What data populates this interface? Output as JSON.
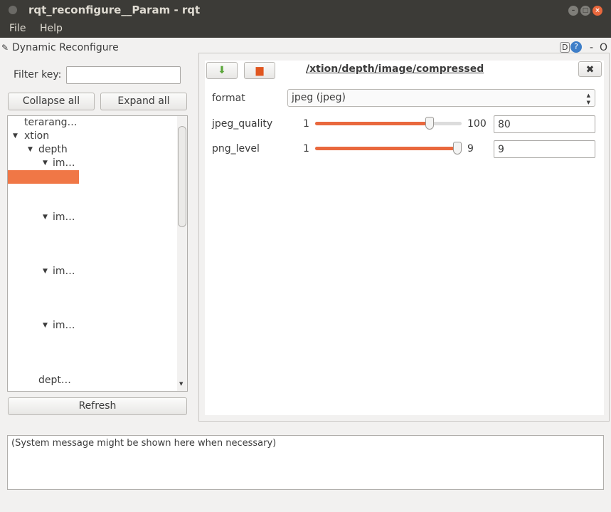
{
  "window": {
    "title": "rqt_reconfigure__Param - rqt"
  },
  "menu": {
    "file": "File",
    "help": "Help"
  },
  "plugin": {
    "title": "Dynamic Reconfigure",
    "d_label": "D",
    "help_label": "?",
    "minimize": "-",
    "close": "O"
  },
  "left": {
    "filter_label": "Filter key:",
    "filter_value": "",
    "collapse_all": "Collapse all",
    "expand_all": "Expand all",
    "refresh": "Refresh",
    "tree": [
      "terarang…",
      "xtion",
      "depth",
      "im…",
      "im…",
      "im…",
      "im…",
      "dept…"
    ]
  },
  "node": {
    "path": "/xtion/depth/image/compressed",
    "params": [
      {
        "name": "format",
        "type": "enum",
        "value": "jpeg (jpeg)"
      },
      {
        "name": "jpeg_quality",
        "min": "1",
        "max": "100",
        "value": "80",
        "fraction": 0.8
      },
      {
        "name": "png_level",
        "min": "1",
        "max": "9",
        "value": "9",
        "fraction": 1.0
      }
    ]
  },
  "status": {
    "message": "(System message might be shown here when necessary)"
  },
  "colors": {
    "accent": "#e9683d",
    "titlebar": "#3c3b37"
  }
}
